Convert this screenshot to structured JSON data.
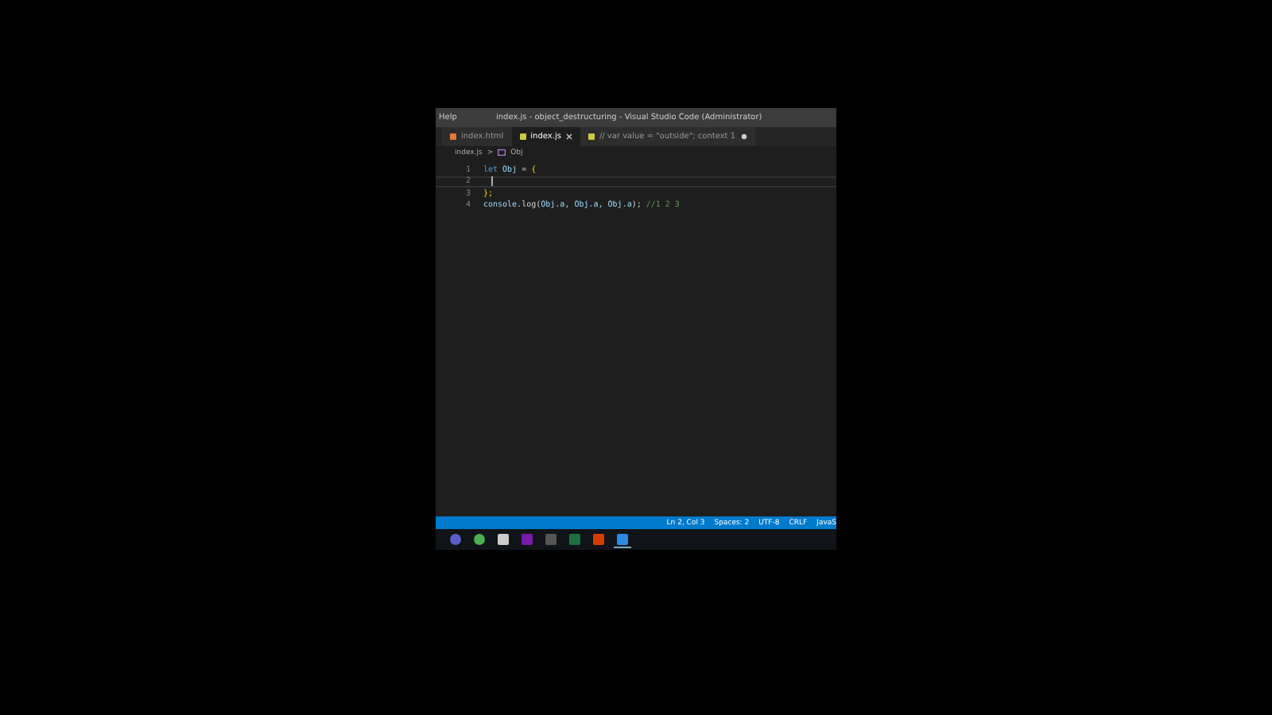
{
  "window": {
    "menu": "Help",
    "title": "index.js - object_destructuring - Visual Studio Code (Administrator)"
  },
  "tabs": [
    {
      "label": "index.html",
      "kind": "html",
      "selected": false,
      "dirty": false
    },
    {
      "label": "index.js",
      "kind": "js",
      "selected": true,
      "dirty": false
    },
    {
      "label": "// var value = \"outside\"; context 1",
      "kind": "js",
      "selected": false,
      "dirty": true
    }
  ],
  "breadcrumb": {
    "file": "index.js",
    "separator": ">",
    "symbol": "Obj"
  },
  "editor": {
    "lines": [
      {
        "number": "1",
        "tokens": [
          {
            "text": "let ",
            "kind": "keyword"
          },
          {
            "text": "Obj",
            "kind": "variable"
          },
          {
            "text": " = ",
            "kind": "plain"
          },
          {
            "text": "{",
            "kind": "bracket"
          }
        ]
      },
      {
        "number": "2"
      },
      {
        "number": "3",
        "tokens": [
          {
            "text": "};",
            "kind": "bracket"
          }
        ]
      },
      {
        "number": "4",
        "tokens": [
          {
            "text": "console",
            "kind": "variable"
          },
          {
            "text": ".log(",
            "kind": "plain"
          },
          {
            "text": "Obj.a, Obj.a, Obj.a",
            "kind": "variable"
          },
          {
            "text": "); ",
            "kind": "plain"
          },
          {
            "text": "//1 2 3",
            "kind": "comment"
          }
        ]
      }
    ]
  },
  "status_bar": {
    "items": [
      "Ln 2, Col 3",
      "Spaces: 2",
      "UTF-8",
      "CRLF",
      "JavaS"
    ]
  },
  "taskbar": {
    "apps": [
      {
        "kind": "teams",
        "selected": false
      },
      {
        "kind": "chrome",
        "selected": false
      },
      {
        "kind": "cloud",
        "selected": false
      },
      {
        "kind": "onenote",
        "selected": false
      },
      {
        "kind": "terminal",
        "selected": false
      },
      {
        "kind": "excel",
        "selected": false
      },
      {
        "kind": "office",
        "selected": false
      },
      {
        "kind": "vscode",
        "selected": true
      }
    ]
  }
}
